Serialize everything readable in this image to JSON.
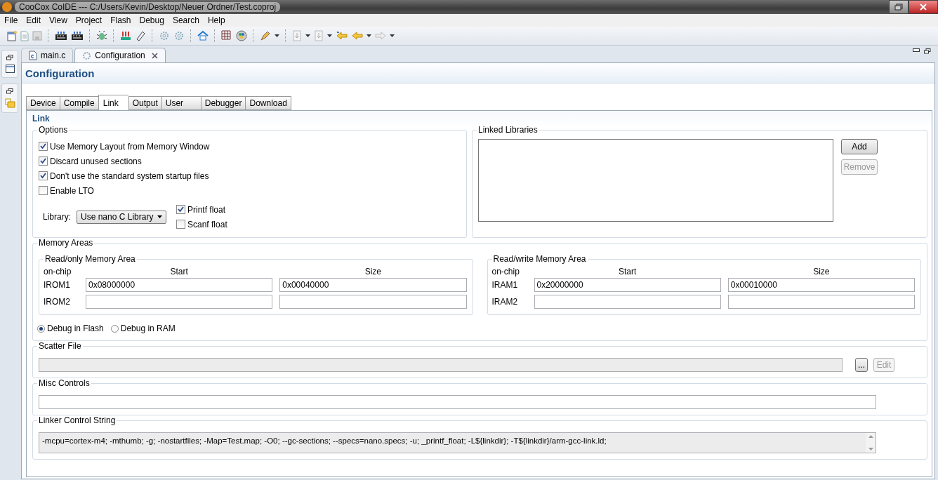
{
  "window": {
    "title": "CooCox CoIDE --- C:/Users/Kevin/Desktop/Neuer Ordner/Test.coproj"
  },
  "menu": [
    "File",
    "Edit",
    "View",
    "Project",
    "Flash",
    "Debug",
    "Search",
    "Help"
  ],
  "editor_tabs": [
    {
      "label": "main.c",
      "selected": false,
      "kind": "source"
    },
    {
      "label": "Configuration",
      "selected": true,
      "kind": "settings"
    }
  ],
  "page_title": "Configuration",
  "config_tabs": [
    {
      "label": "Device",
      "selected": false
    },
    {
      "label": "Compile",
      "selected": false
    },
    {
      "label": "Link",
      "selected": true
    },
    {
      "label": "Output",
      "selected": false
    },
    {
      "label": "User",
      "selected": false
    },
    {
      "label": "Debugger",
      "selected": false
    },
    {
      "label": "Download",
      "selected": false
    }
  ],
  "section_title": "Link",
  "options": {
    "title": "Options",
    "checkboxes": [
      {
        "label": "Use Memory Layout from Memory Window",
        "checked": true
      },
      {
        "label": "Discard unused sections",
        "checked": true
      },
      {
        "label": "Don't use the standard system startup files",
        "checked": true
      },
      {
        "label": "Enable LTO",
        "checked": false
      }
    ],
    "library": {
      "label": "Library:",
      "value": "Use nano C Library"
    },
    "float_options": [
      {
        "label": "Printf float",
        "checked": true
      },
      {
        "label": "Scanf float",
        "checked": false
      }
    ]
  },
  "linked_libraries": {
    "title": "Linked Libraries",
    "buttons": [
      {
        "label": "Add",
        "disabled": false
      },
      {
        "label": "Remove",
        "disabled": true
      }
    ]
  },
  "memory_areas": {
    "title": "Memory Areas",
    "groups": [
      {
        "title": "Read/only Memory Area",
        "columns": [
          "on-chip",
          "Start",
          "Size"
        ],
        "rows": [
          {
            "name": "IROM1",
            "start": "0x08000000",
            "size": "0x00040000"
          },
          {
            "name": "IROM2",
            "start": "",
            "size": ""
          }
        ]
      },
      {
        "title": "Read/write Memory Area",
        "columns": [
          "on-chip",
          "Start",
          "Size"
        ],
        "rows": [
          {
            "name": "IRAM1",
            "start": "0x20000000",
            "size": "0x00010000"
          },
          {
            "name": "IRAM2",
            "start": "",
            "size": ""
          }
        ]
      }
    ],
    "debug_modes": [
      {
        "label": "Debug in Flash",
        "selected": true
      },
      {
        "label": "Debug in RAM",
        "selected": false
      }
    ]
  },
  "scatter_file": {
    "title": "Scatter File",
    "buttons": [
      {
        "label": "...",
        "disabled": false
      },
      {
        "label": "Edit",
        "disabled": true
      }
    ]
  },
  "misc_controls": {
    "title": "Misc Controls"
  },
  "linker_control_string": {
    "title": "Linker Control String",
    "value": "-mcpu=cortex-m4; -mthumb; -g; -nostartfiles; -Map=Test.map; -O0; --gc-sections; --specs=nano.specs; -u; _printf_float; -L${linkdir}; -T${linkdir}/arm-gcc-link.ld;"
  }
}
